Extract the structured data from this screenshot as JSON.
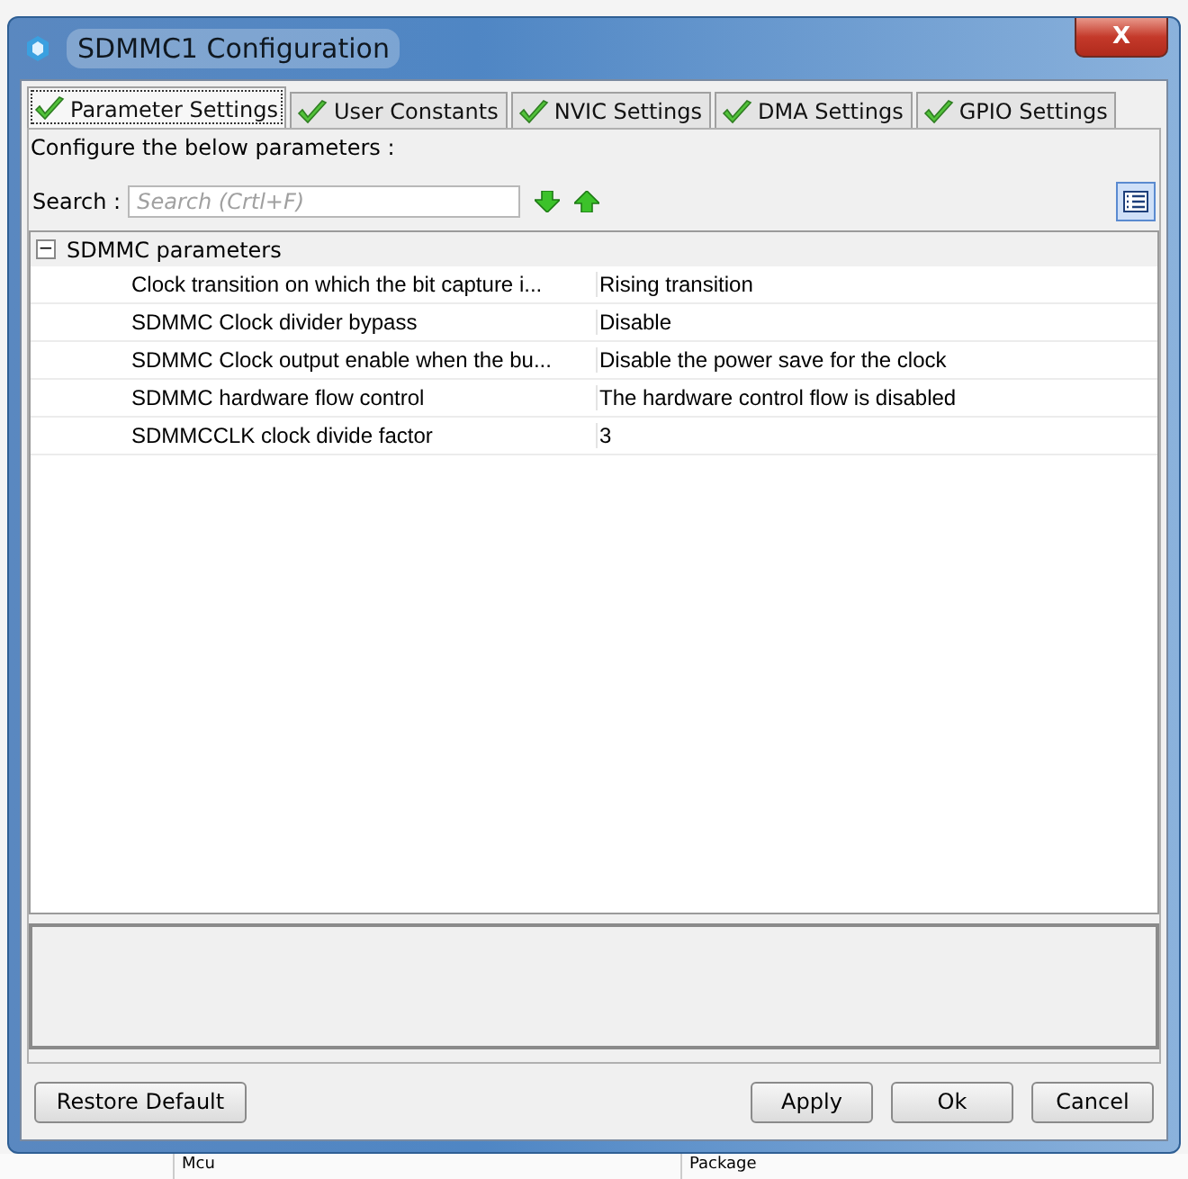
{
  "window": {
    "title": "SDMMC1 Configuration",
    "close": "X"
  },
  "tabs": [
    {
      "label": "Parameter Settings",
      "selected": true,
      "checked": true
    },
    {
      "label": "User Constants",
      "selected": false,
      "checked": true
    },
    {
      "label": "NVIC Settings",
      "selected": false,
      "checked": true
    },
    {
      "label": "DMA Settings",
      "selected": false,
      "checked": true
    },
    {
      "label": "GPIO Settings",
      "selected": false,
      "checked": true
    }
  ],
  "intro": "Configure the below parameters :",
  "search": {
    "label": "Search :",
    "placeholder": "Search (Crtl+F)"
  },
  "tree": {
    "label": "SDMMC parameters",
    "expanded": true,
    "toggle": "−",
    "children": [
      {
        "name": "Clock transition on which the bit capture i...",
        "value": "Rising transition"
      },
      {
        "name": "SDMMC Clock divider bypass",
        "value": "Disable"
      },
      {
        "name": "SDMMC Clock output enable when the bu...",
        "value": "Disable the power save for the clock"
      },
      {
        "name": "SDMMC hardware flow control",
        "value": "The hardware control flow is disabled"
      },
      {
        "name": "SDMMCCLK clock divide factor",
        "value": "3"
      }
    ]
  },
  "buttons": {
    "left": [
      "Restore Default"
    ],
    "right": [
      "Apply",
      "Ok",
      "Cancel"
    ]
  },
  "background_table": {
    "columns": [
      "Mcu",
      "Package"
    ]
  }
}
